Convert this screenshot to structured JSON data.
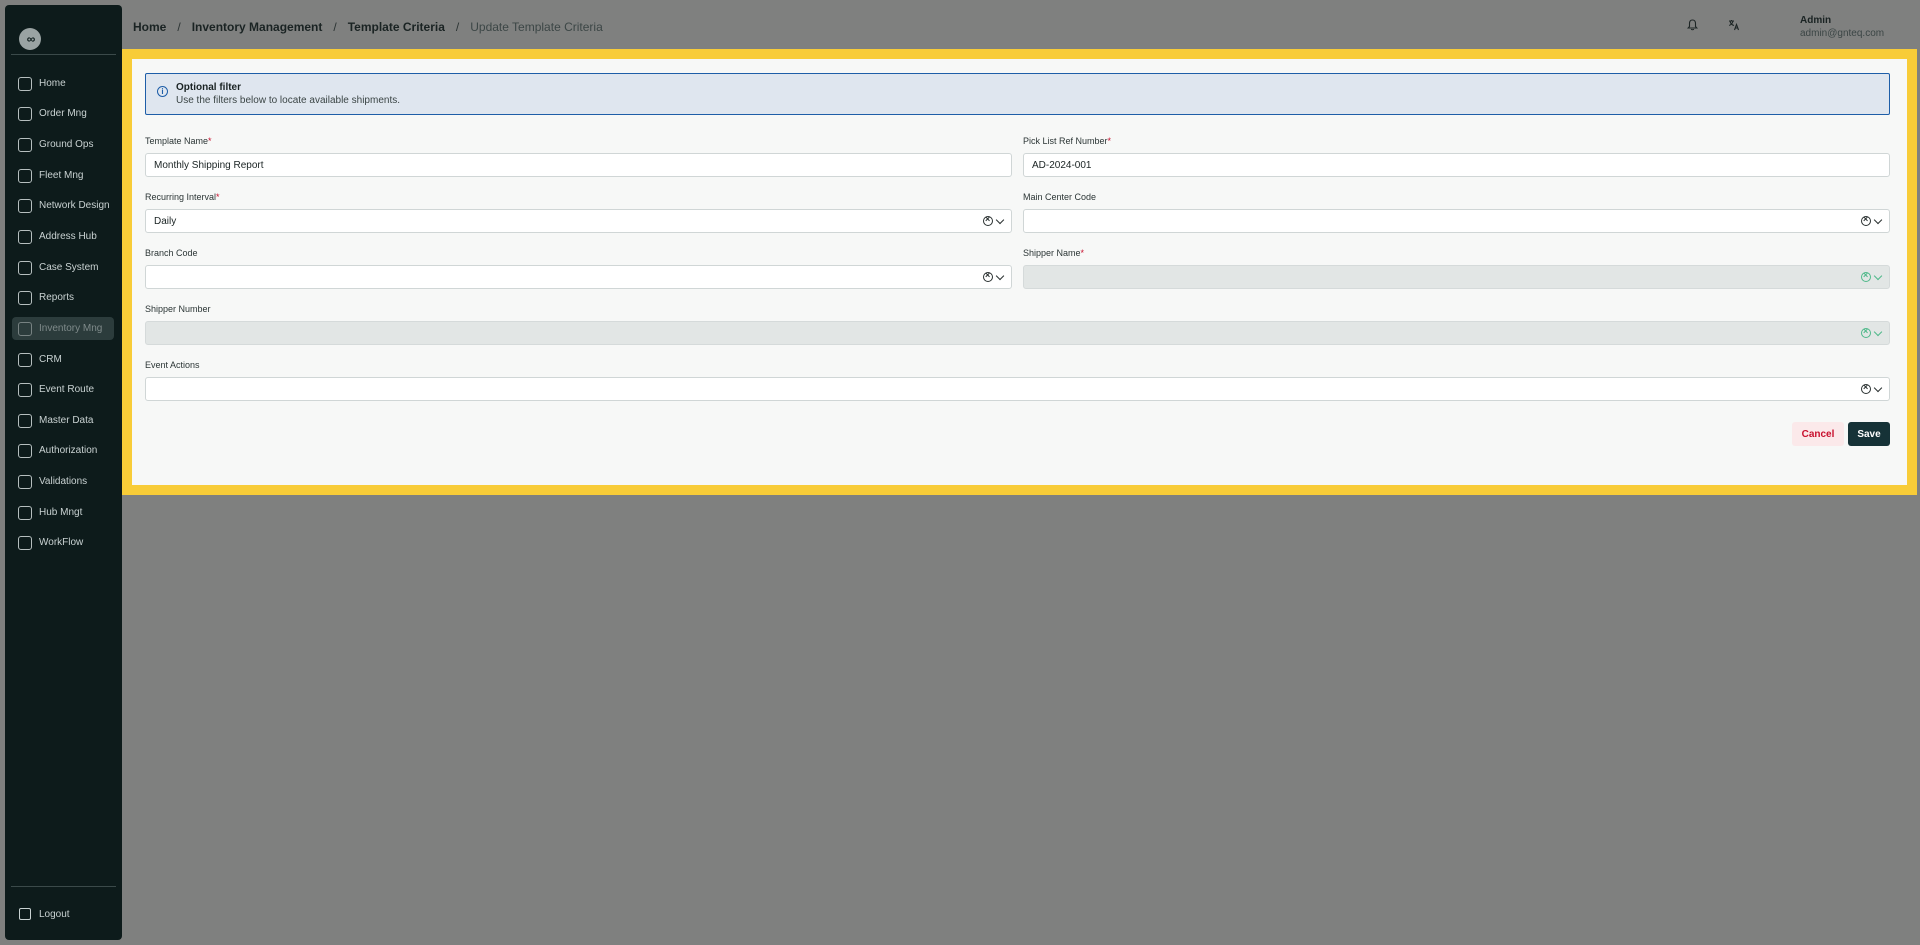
{
  "logo": {
    "glyph": "∞"
  },
  "sidebar": {
    "items": [
      {
        "label": "Home",
        "icon": "home-icon"
      },
      {
        "label": "Order Mng",
        "icon": "order-icon"
      },
      {
        "label": "Ground Ops",
        "icon": "ground-ops-icon"
      },
      {
        "label": "Fleet Mng",
        "icon": "truck-icon"
      },
      {
        "label": "Network Design",
        "icon": "network-icon"
      },
      {
        "label": "Address Hub",
        "icon": "address-icon"
      },
      {
        "label": "Case System",
        "icon": "case-icon"
      },
      {
        "label": "Reports",
        "icon": "reports-icon"
      },
      {
        "label": "Inventory Mng",
        "icon": "inventory-icon",
        "active": true
      },
      {
        "label": "CRM",
        "icon": "crm-icon"
      },
      {
        "label": "Event Route",
        "icon": "route-icon"
      },
      {
        "label": "Master Data",
        "icon": "database-icon"
      },
      {
        "label": "Authorization",
        "icon": "users-icon"
      },
      {
        "label": "Validations",
        "icon": "validation-icon"
      },
      {
        "label": "Hub Mngt",
        "icon": "hub-icon"
      },
      {
        "label": "WorkFlow",
        "icon": "workflow-icon"
      }
    ],
    "logout": "Logout"
  },
  "breadcrumb": {
    "home": "Home",
    "inventory": "Inventory Management",
    "criteria": "Template Criteria",
    "current": "Update Template Criteria",
    "separator": "/"
  },
  "header": {
    "user_name": "Admin",
    "user_email": "admin@gnteq.com"
  },
  "info": {
    "title": "Optional filter",
    "text": "Use the filters below to locate available shipments."
  },
  "form": {
    "template_name": {
      "label": "Template Name",
      "value": "Monthly Shipping Report"
    },
    "pick_list": {
      "label": "Pick List Ref Number",
      "value": "AD-2024-001"
    },
    "recurring_interval": {
      "label": "Recurring Interval",
      "value": "Daily"
    },
    "main_center_code": {
      "label": "Main Center Code",
      "value": ""
    },
    "branch_code": {
      "label": "Branch Code",
      "value": ""
    },
    "shipper_name": {
      "label": "Shipper Name",
      "value": ""
    },
    "shipper_number": {
      "label": "Shipper Number",
      "value": ""
    },
    "event_actions": {
      "label": "Event Actions",
      "value": ""
    },
    "required_mark": "*"
  },
  "buttons": {
    "cancel": "Cancel",
    "save": "Save"
  }
}
